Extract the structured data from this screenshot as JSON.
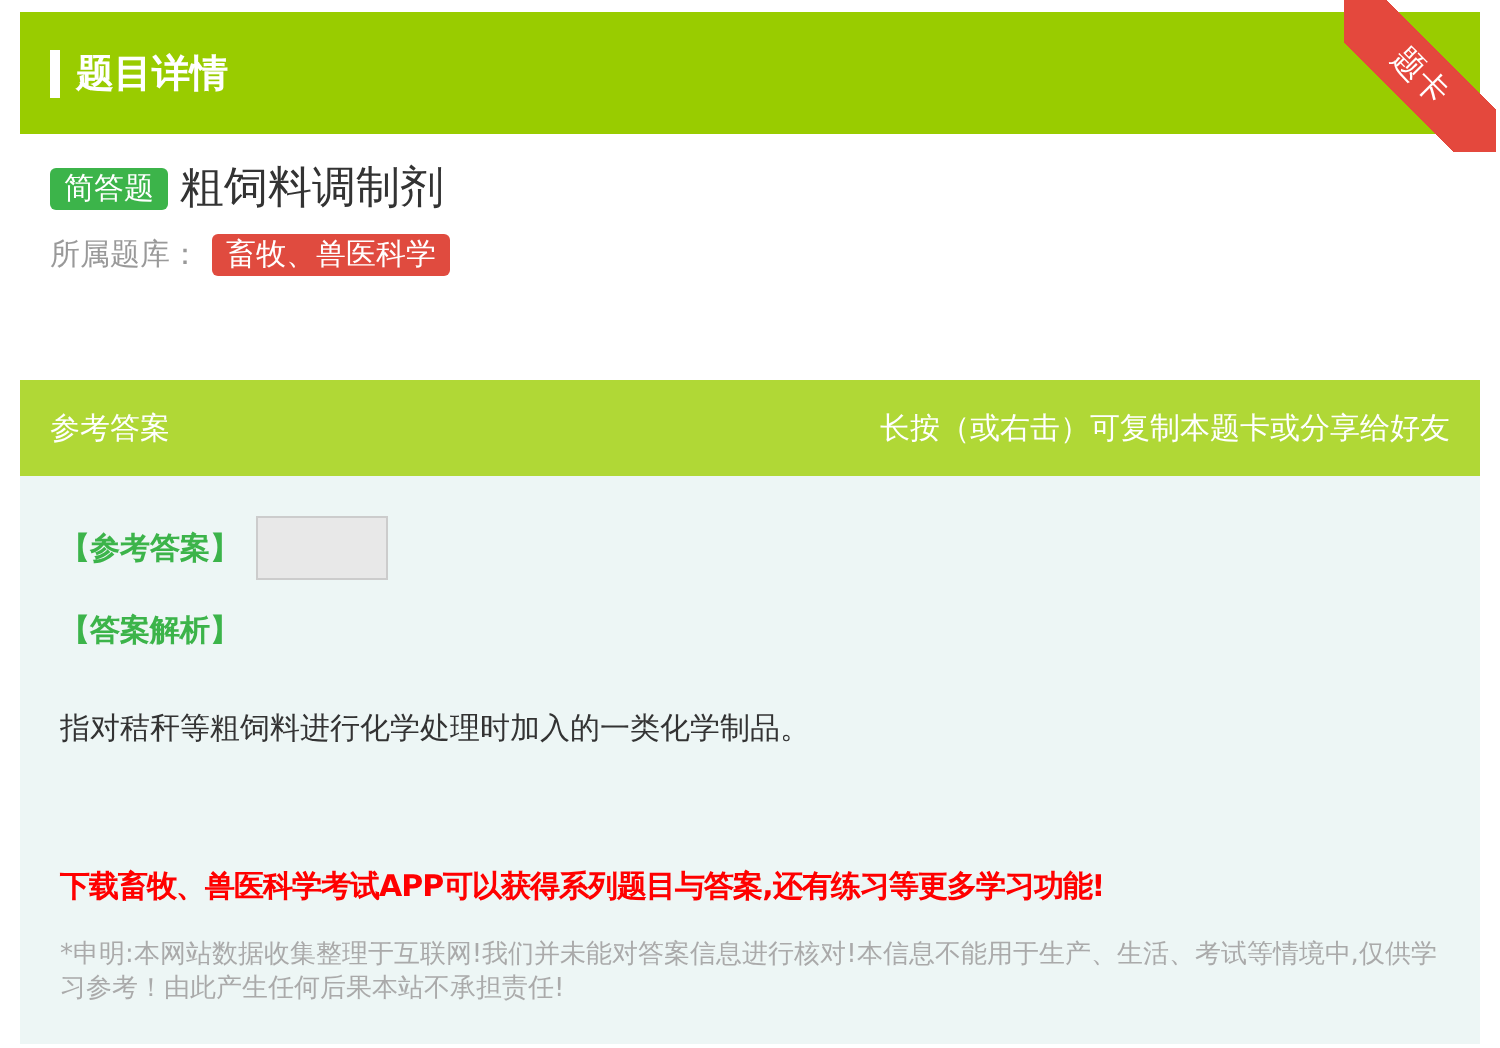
{
  "header": {
    "title": "题目详情",
    "ribbon": "题卡"
  },
  "question": {
    "type_tag": "简答题",
    "title": "粗饲料调制剂",
    "bank_label": "所属题库：",
    "bank_tag": "畜牧、兽医科学"
  },
  "answer_panel": {
    "title": "参考答案",
    "hint": "长按（或右击）可复制本题卡或分享给好友",
    "answer_label": "【参考答案】",
    "analysis_label": "【答案解析】",
    "analysis": "指对秸秆等粗饲料进行化学处理时加入的一类化学制品。",
    "promo": "下载畜牧、兽医科学考试APP可以获得系列题目与答案,还有练习等更多学习功能!",
    "disclaimer": "*申明:本网站数据收集整理于互联网!我们并未能对答案信息进行核对!本信息不能用于生产、生活、考试等情境中,仅供学习参考！由此产生任何后果本站不承担责任!"
  }
}
